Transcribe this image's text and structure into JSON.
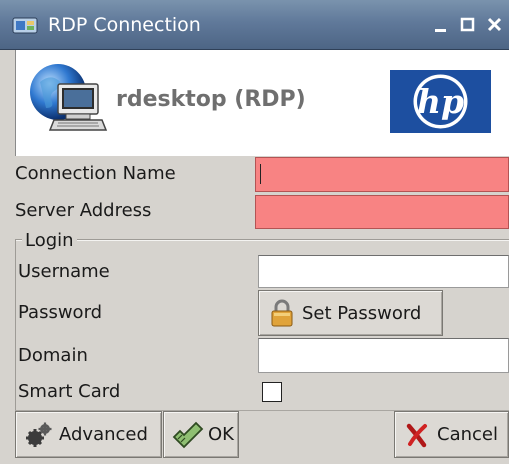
{
  "window": {
    "title": "RDP Connection",
    "controls": {
      "minimize": "_",
      "maximize": "□",
      "close": "×"
    }
  },
  "header": {
    "title": "rdesktop (RDP)",
    "logo_text": "hp",
    "icon": "computer-globe-icon"
  },
  "form": {
    "connection_name": {
      "label": "Connection Name",
      "value": "",
      "status": "error"
    },
    "server_address": {
      "label": "Server Address",
      "value": "",
      "status": "error"
    },
    "login": {
      "group_label": "Login",
      "username": {
        "label": "Username",
        "value": ""
      },
      "password": {
        "label": "Password",
        "button_label": "Set Password",
        "icon": "padlock-icon"
      },
      "domain": {
        "label": "Domain",
        "value": ""
      },
      "smart_card": {
        "label": "Smart Card",
        "checked": false
      }
    }
  },
  "buttons": {
    "advanced": {
      "label": "Advanced",
      "icon": "gears-icon"
    },
    "ok": {
      "label": "OK",
      "icon": "checkmark-hand-icon"
    },
    "cancel": {
      "label": "Cancel",
      "icon": "red-x-icon"
    }
  },
  "colors": {
    "titlebar": "#60799a",
    "error_field": "#f88383",
    "window_bg": "#d6d3ce",
    "hp_blue": "#1d4fa0"
  }
}
